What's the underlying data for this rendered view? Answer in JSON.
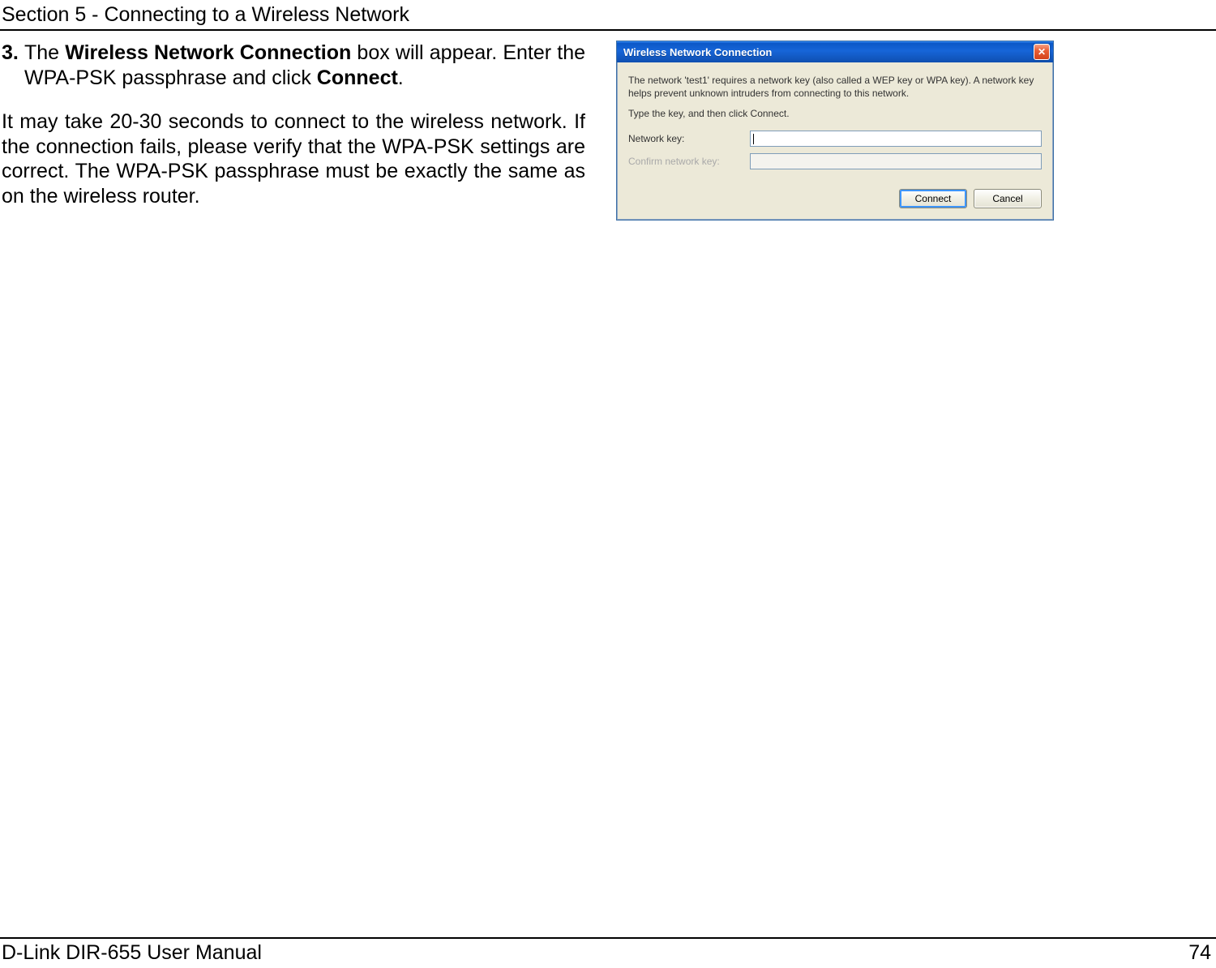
{
  "header": {
    "section_title": "Section 5 - Connecting to a Wireless Network"
  },
  "content": {
    "step_number": "3.",
    "step_part1": "The ",
    "step_bold1": "Wireless Network Connection",
    "step_part2": " box will appear. Enter the WPA-PSK passphrase and click ",
    "step_bold2": "Connect",
    "step_part3": ".",
    "para": "It may take 20-30 seconds to connect to the wireless network. If the connection fails, please verify that the WPA-PSK settings are correct. The WPA-PSK passphrase must be exactly the same as on the wireless router."
  },
  "dialog": {
    "title": "Wireless Network Connection",
    "close_glyph": "✕",
    "info_line1": "The network 'test1' requires a network key (also called a WEP key or WPA key). A network key helps prevent unknown intruders from connecting to this network.",
    "info_line2": "Type the key, and then click Connect.",
    "label_key": "Network key:",
    "label_confirm": "Confirm network key:",
    "btn_connect": "Connect",
    "btn_cancel": "Cancel"
  },
  "footer": {
    "manual": "D-Link DIR-655 User Manual",
    "page": "74"
  }
}
